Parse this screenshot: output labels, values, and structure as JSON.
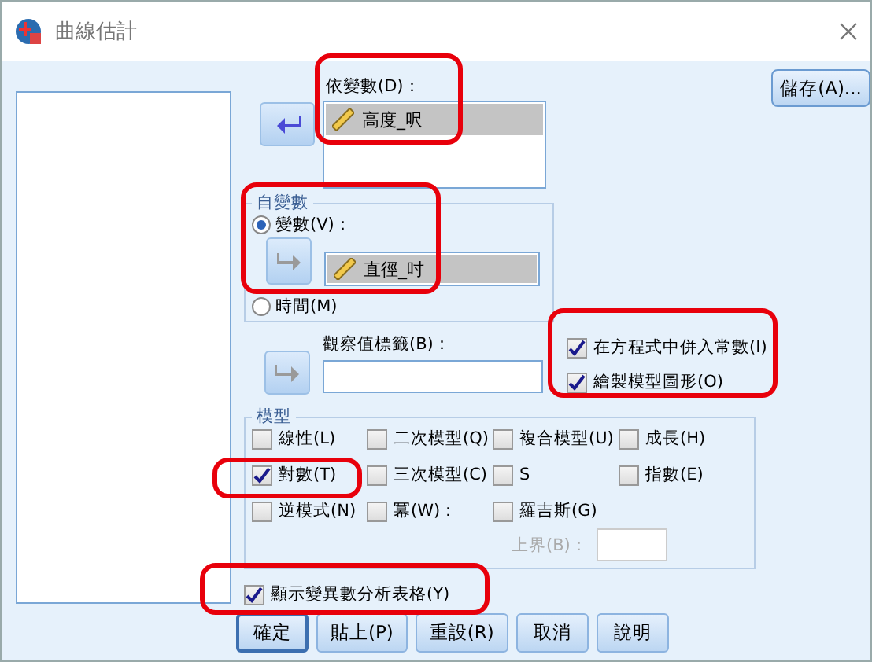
{
  "window": {
    "title": "曲線估計"
  },
  "dependent": {
    "label": "依變數(D)：",
    "transfer_enabled": true,
    "items": [
      {
        "name": "高度_呎",
        "selected": true
      }
    ]
  },
  "save_button": "儲存(A)...",
  "independent": {
    "title": "自變數",
    "transfer_enabled": false,
    "options": [
      {
        "label": "變數(V)：",
        "selected": true
      },
      {
        "label": "時間(M)",
        "selected": false
      }
    ],
    "variable": {
      "name": "直徑_吋",
      "selected": true
    }
  },
  "case_labels": {
    "label": "觀察值標籤(B)：",
    "transfer_enabled": false
  },
  "options": [
    {
      "label": "在方程式中併入常數(I)",
      "checked": true
    },
    {
      "label": "繪製模型圖形(O)",
      "checked": true
    }
  ],
  "models": {
    "title": "模型",
    "rows": [
      [
        {
          "label": "線性(L)",
          "checked": false
        },
        {
          "label": "二次模型(Q)",
          "checked": false
        },
        {
          "label": "複合模型(U)",
          "checked": false
        },
        {
          "label": "成長(H)",
          "checked": false
        }
      ],
      [
        {
          "label": "對數(T)",
          "checked": true
        },
        {
          "label": "三次模型(C)",
          "checked": false
        },
        {
          "label": "S",
          "checked": false
        },
        {
          "label": "指數(E)",
          "checked": false
        }
      ],
      [
        {
          "label": "逆模式(N)",
          "checked": false
        },
        {
          "label": "冪(W)：",
          "checked": false
        },
        {
          "label": "羅吉斯(G)",
          "checked": false
        }
      ]
    ],
    "upper_bound": {
      "label": "上界(B)：",
      "disabled": true
    }
  },
  "anova": {
    "label": "顯示變異數分析表格(Y)",
    "checked": true
  },
  "buttons": [
    {
      "label": "確定",
      "default": true
    },
    {
      "label": "貼上(P)",
      "default": false
    },
    {
      "label": "重設(R)",
      "default": false
    },
    {
      "label": "取消",
      "default": false
    },
    {
      "label": "說明",
      "default": false
    }
  ]
}
